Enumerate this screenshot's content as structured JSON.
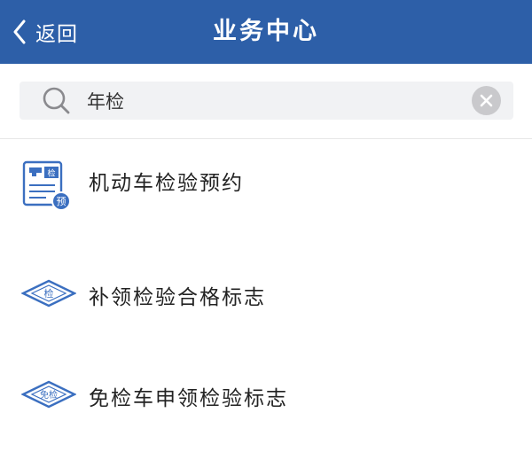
{
  "header": {
    "back_label": "返回",
    "title": "业务中心",
    "background": "#2d5fa8"
  },
  "search": {
    "value": "年检",
    "placeholder": "",
    "icon": "search-icon",
    "clear_icon": "clear-icon"
  },
  "results": [
    {
      "label": "机动车检验预约",
      "icon": "inspection-booking-icon",
      "badge_text": "检",
      "badge2_text": "预"
    },
    {
      "label": "补领检验合格标志",
      "icon": "inspection-sign-icon",
      "badge_text": "检"
    },
    {
      "label": "免检车申领检验标志",
      "icon": "exempt-sign-icon",
      "badge_text": "免检"
    }
  ],
  "colors": {
    "accent": "#2d5fa8",
    "icon_blue": "#3b6fc0",
    "search_bg": "#f1f2f4"
  }
}
